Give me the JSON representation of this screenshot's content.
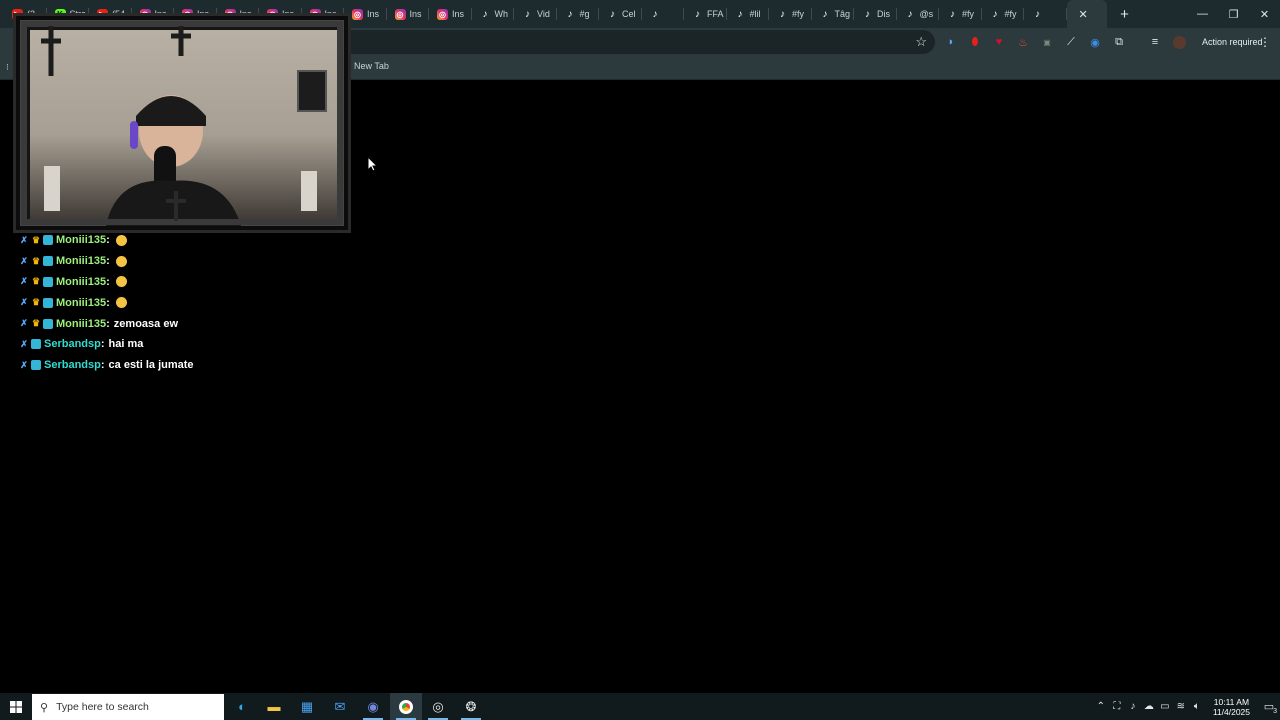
{
  "browser": {
    "tabs": [
      {
        "icon": "youtube",
        "label": "(2"
      },
      {
        "icon": "kick",
        "label": "Stre"
      },
      {
        "icon": "youtube",
        "label": "(54"
      },
      {
        "icon": "instagram",
        "label": "Ins"
      },
      {
        "icon": "instagram",
        "label": "Ins"
      },
      {
        "icon": "instagram",
        "label": "Ins"
      },
      {
        "icon": "instagram",
        "label": "Ins"
      },
      {
        "icon": "instagram",
        "label": "Ins"
      },
      {
        "icon": "instagram",
        "label": "Ins"
      },
      {
        "icon": "instagram",
        "label": "Ins"
      },
      {
        "icon": "instagram",
        "label": "Ins"
      },
      {
        "icon": "tiktok",
        "label": "Wh"
      },
      {
        "icon": "tiktok",
        "label": "Vid"
      },
      {
        "icon": "tiktok",
        "label": "#g"
      },
      {
        "icon": "tiktok",
        "label": "Cel"
      },
      {
        "icon": "tiktok",
        "label": ""
      },
      {
        "icon": "tiktok",
        "label": "FFA"
      },
      {
        "icon": "tiktok",
        "label": "#lil"
      },
      {
        "icon": "tiktok",
        "label": "#fy"
      },
      {
        "icon": "tiktok",
        "label": "Tâg"
      },
      {
        "icon": "tiktok",
        "label": "Dis"
      },
      {
        "icon": "tiktok",
        "label": "@s"
      },
      {
        "icon": "tiktok",
        "label": "#fy"
      },
      {
        "icon": "tiktok",
        "label": "#fy"
      },
      {
        "icon": "tiktok",
        "label": ""
      }
    ],
    "active_tab_close": "✕",
    "new_tab_symbol": "+",
    "window_controls": {
      "minimize": "—",
      "restore": "❐",
      "close": "✕"
    },
    "action_required_label": "Action required",
    "bookmarks": [
      {
        "label": "New Tab"
      }
    ]
  },
  "chat": {
    "messages": [
      {
        "badges": [
          "sword",
          "crown",
          "sub"
        ],
        "username": "Moniii135",
        "user_color": "#9cef7b",
        "text": "",
        "emote": true
      },
      {
        "badges": [
          "sword",
          "crown",
          "sub"
        ],
        "username": "Moniii135",
        "user_color": "#9cef7b",
        "text": "",
        "emote": true
      },
      {
        "badges": [
          "sword",
          "crown",
          "sub"
        ],
        "username": "Moniii135",
        "user_color": "#9cef7b",
        "text": "",
        "emote": true
      },
      {
        "badges": [
          "sword",
          "crown",
          "sub"
        ],
        "username": "Moniii135",
        "user_color": "#9cef7b",
        "text": "",
        "emote": true
      },
      {
        "badges": [
          "sword",
          "crown",
          "sub"
        ],
        "username": "Moniii135",
        "user_color": "#9cef7b",
        "text": "zemoasa ew",
        "emote": false
      },
      {
        "badges": [
          "sword",
          "sub"
        ],
        "username": "Serbandsp",
        "user_color": "#33d9d2",
        "text": "hai ma",
        "emote": false
      },
      {
        "badges": [
          "sword",
          "sub"
        ],
        "username": "Serbandsp",
        "user_color": "#33d9d2",
        "text": "ca esti la jumate",
        "emote": false
      }
    ]
  },
  "taskbar": {
    "search_placeholder": "Type here to search",
    "apps": [
      "edge-icon",
      "file-explorer-icon",
      "store-icon",
      "mail-icon",
      "discord-icon",
      "chrome-icon",
      "obs-icon",
      "steam-icon"
    ],
    "clock_time": "10:11 AM",
    "clock_date": "11/4/2025",
    "notification_count": "3"
  }
}
